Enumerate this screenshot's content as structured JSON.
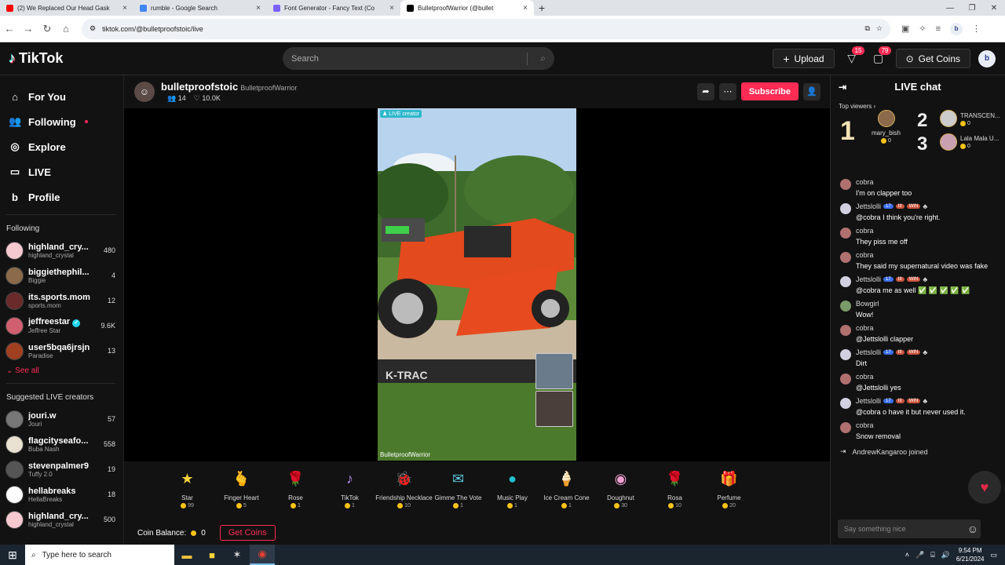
{
  "browser": {
    "tabs": [
      {
        "title": "(2) We Replaced Our Head Gask",
        "color": "#ff0000"
      },
      {
        "title": "rumble - Google Search",
        "color": "#4285f4"
      },
      {
        "title": "Font Generator - Fancy Text (Co",
        "color": "#7b61ff"
      },
      {
        "title": "BulletproofWarrior (@bullet",
        "color": "#000000"
      }
    ],
    "url": "tiktok.com/@bulletproofstoic/live"
  },
  "header": {
    "logo": "TikTok",
    "search_placeholder": "Search",
    "upload_label": "Upload",
    "inbox_badge": "15",
    "messages_badge": "79",
    "get_coins_label": "Get Coins",
    "avatar_letter": "b"
  },
  "sidebar": {
    "nav": [
      {
        "label": "For You",
        "icon": "home-icon",
        "glyph": "⌂"
      },
      {
        "label": "Following",
        "icon": "following-icon",
        "glyph": "👥"
      },
      {
        "label": "Explore",
        "icon": "explore-icon",
        "glyph": "◎"
      },
      {
        "label": "LIVE",
        "icon": "live-icon",
        "glyph": "▭"
      },
      {
        "label": "Profile",
        "icon": "profile-icon",
        "glyph": "b"
      }
    ],
    "following_title": "Following",
    "following": [
      {
        "name": "highland_cry...",
        "sub": "highland_crystal",
        "count": "480",
        "color": "#f6c9d0"
      },
      {
        "name": "biggiethephil...",
        "sub": "Biggie",
        "count": "4",
        "color": "#8a6a4a"
      },
      {
        "name": "its.sports.mom",
        "sub": "sports.mom",
        "count": "12",
        "color": "#6a2a2a"
      },
      {
        "name": "jeffreestar",
        "sub": "Jeffree Star",
        "count": "9.6K",
        "color": "#d06070",
        "verified": true
      },
      {
        "name": "user5bqa6jrsjn",
        "sub": "Paradise",
        "count": "13",
        "color": "#a04020"
      }
    ],
    "see_all": "See all",
    "suggested_title": "Suggested LIVE creators",
    "suggested": [
      {
        "name": "jouri.w",
        "sub": "Jouri",
        "count": "57",
        "color": "#777777"
      },
      {
        "name": "flagcityseafo...",
        "sub": "Buba Nash",
        "count": "558",
        "color": "#e8e0d0"
      },
      {
        "name": "stevenpalmer9",
        "sub": "Tuffy 2.0",
        "count": "19",
        "color": "#555555"
      },
      {
        "name": "hellabreaks",
        "sub": "HellaBreaks",
        "count": "18",
        "color": "#ffffff"
      },
      {
        "name": "highland_cry...",
        "sub": "highland_crystal",
        "count": "500",
        "color": "#f6c9d0"
      }
    ]
  },
  "stream": {
    "username": "bulletproofstoic",
    "display_name": "BulletproofWarrior",
    "viewers": "14",
    "likes": "10.0K",
    "subscribe_label": "Subscribe",
    "live_tag": "LIVE creator",
    "cam_label": "BulletproofWarrior"
  },
  "gifts": [
    {
      "name": "Star",
      "price": "99",
      "glyph": "★",
      "color": "#f5d33a"
    },
    {
      "name": "Finger Heart",
      "price": "5",
      "glyph": "🫰",
      "color": "#f4a070"
    },
    {
      "name": "Rose",
      "price": "1",
      "glyph": "🌹",
      "color": "#e0223a"
    },
    {
      "name": "TikTok",
      "price": "1",
      "glyph": "♪",
      "color": "#b48cf0"
    },
    {
      "name": "Friendship Necklace",
      "price": "10",
      "glyph": "🐞",
      "color": "#c06050"
    },
    {
      "name": "Gimme The Vote",
      "price": "1",
      "glyph": "✉",
      "color": "#5fc8e0"
    },
    {
      "name": "Music Play",
      "price": "1",
      "glyph": "●",
      "color": "#20c0d0"
    },
    {
      "name": "Ice Cream Cone",
      "price": "1",
      "glyph": "🍦",
      "color": "#f0a0c0"
    },
    {
      "name": "Doughnut",
      "price": "30",
      "glyph": "◉",
      "color": "#f0a0d0"
    },
    {
      "name": "Rosa",
      "price": "10",
      "glyph": "🌹",
      "color": "#d02030"
    },
    {
      "name": "Perfume",
      "price": "20",
      "glyph": "🎁",
      "color": "#f07090"
    }
  ],
  "balance": {
    "label": "Coin Balance:",
    "value": "0",
    "button": "Get Coins"
  },
  "chat": {
    "title": "LIVE chat",
    "top_viewers_label": "Top viewers",
    "rank1": {
      "num": "1",
      "name": "mary_bish",
      "coins": "0"
    },
    "rank2": {
      "num": "2",
      "name": "TRANSCEN...",
      "coins": "0"
    },
    "rank3": {
      "num": "3",
      "name": "Lala Mala U...",
      "coins": "0"
    },
    "messages": [
      {
        "user": "cobra",
        "text": "I'm on clapper too",
        "badges": false,
        "color": "#b07070"
      },
      {
        "user": "Jettslolli",
        "text": "@cobra I think you're right.",
        "badges": true,
        "color": "#d0d0e0"
      },
      {
        "user": "cobra",
        "text": "They piss me off",
        "badges": false,
        "color": "#b07070"
      },
      {
        "user": "cobra",
        "text": "They said my supernatural video was fake",
        "badges": false,
        "color": "#b07070"
      },
      {
        "user": "Jettslolli",
        "text": "@cobra me as well ✅ ✅ ✅ ✅ ✅",
        "badges": true,
        "color": "#d0d0e0"
      },
      {
        "user": "Bowgirl",
        "text": "Wow!",
        "badges": false,
        "color": "#7a9a6a"
      },
      {
        "user": "cobra",
        "text": "@Jettslolli clapper",
        "badges": false,
        "color": "#b07070"
      },
      {
        "user": "Jettslolli",
        "text": "Dirt",
        "badges": true,
        "color": "#d0d0e0"
      },
      {
        "user": "cobra",
        "text": "@Jettslolli yes",
        "badges": false,
        "color": "#b07070"
      },
      {
        "user": "Jettslolli",
        "text": "@cobra o have it but never used it.",
        "badges": true,
        "color": "#d0d0e0"
      },
      {
        "user": "cobra",
        "text": "Snow removal",
        "badges": false,
        "color": "#b07070"
      }
    ],
    "badge_level": "17",
    "badge_fan": "III",
    "badge_win": "WIN",
    "joined_text": "AndrewKangaroo joined",
    "input_placeholder": "Say something nice"
  },
  "taskbar": {
    "search_placeholder": "Type here to search",
    "time": "9:54 PM",
    "date": "6/21/2024"
  }
}
